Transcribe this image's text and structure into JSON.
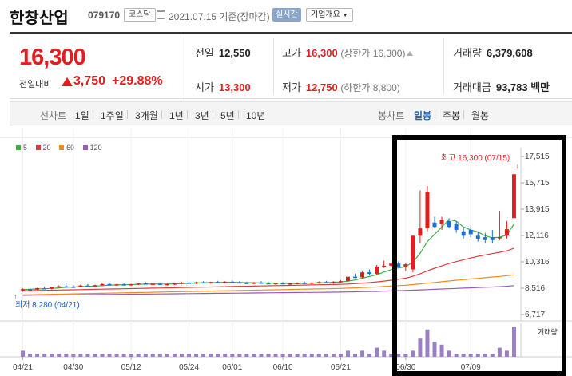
{
  "header": {
    "company_name": "한창산업",
    "stock_code": "079170",
    "market_badge": "코스닥",
    "date_text": "2021.07.15 기준(장마감)",
    "realtime_label": "실시간",
    "company_info_label": "기업개요"
  },
  "summary": {
    "current_price": "16,300",
    "change_label": "전일대비",
    "change_value": "3,750",
    "change_percent": "+29.88%",
    "prev_close_label": "전일",
    "prev_close": "12,550",
    "open_label": "시가",
    "open": "13,300",
    "high_label": "고가",
    "high": "16,300",
    "high_note": "(상한가 16,300)",
    "low_label": "저가",
    "low": "12,750",
    "low_note": "(하한가 8,800)",
    "volume_label": "거래량",
    "volume": "6,379,608",
    "trade_value_label": "거래대금",
    "trade_value": "93,783 백만"
  },
  "period_bar": {
    "line_chart_label": "선차트",
    "periods": [
      "1일",
      "1주일",
      "3개월",
      "1년",
      "3년",
      "5년",
      "10년"
    ],
    "candle_label": "봉차트",
    "candle_periods": [
      "일봉",
      "주봉",
      "월봉"
    ],
    "selected": "일봉"
  },
  "legend": [
    {
      "label": "5",
      "color": "#3cb043"
    },
    {
      "label": "20",
      "color": "#e03c3c"
    },
    {
      "label": "60",
      "color": "#f08c1e"
    },
    {
      "label": "120",
      "color": "#9b59b6"
    }
  ],
  "colors": {
    "up": "#e41e1e",
    "down": "#1a6fd6",
    "ma5": "#3cb043",
    "ma20": "#e03c3c",
    "ma60": "#f08c1e",
    "ma120": "#9b59b6",
    "volume": "#9b7fc4",
    "highlight_box": "#000000"
  },
  "chart_data": {
    "type": "candlestick",
    "y_ticks": [
      "17,515",
      "15,715",
      "13,915",
      "12,116",
      "10,316",
      "8,516",
      "6,717"
    ],
    "ylim": [
      6717,
      17515
    ],
    "x_ticks": [
      "04/21",
      "04/30",
      "05/12",
      "05/24",
      "06/01",
      "06/10",
      "06/21",
      "06/30",
      "07/09"
    ],
    "max_annotation": "최고 16,300 (07/15)",
    "min_annotation": "최저 8,280 (04/21)",
    "volume_label": "거래량",
    "candles": [
      {
        "o": 8380,
        "h": 8500,
        "l": 8280,
        "c": 8450
      },
      {
        "o": 8450,
        "h": 8560,
        "l": 8380,
        "c": 8420
      },
      {
        "o": 8420,
        "h": 8550,
        "l": 8400,
        "c": 8520
      },
      {
        "o": 8520,
        "h": 8620,
        "l": 8450,
        "c": 8480
      },
      {
        "o": 8480,
        "h": 8600,
        "l": 8440,
        "c": 8580
      },
      {
        "o": 8580,
        "h": 8700,
        "l": 8520,
        "c": 8640
      },
      {
        "o": 8640,
        "h": 8900,
        "l": 8600,
        "c": 8620
      },
      {
        "o": 8620,
        "h": 8720,
        "l": 8560,
        "c": 8600
      },
      {
        "o": 8600,
        "h": 8760,
        "l": 8580,
        "c": 8700
      },
      {
        "o": 8700,
        "h": 8800,
        "l": 8620,
        "c": 8660
      },
      {
        "o": 8660,
        "h": 8760,
        "l": 8600,
        "c": 8720
      },
      {
        "o": 8720,
        "h": 8900,
        "l": 8660,
        "c": 8800
      },
      {
        "o": 8800,
        "h": 8880,
        "l": 8700,
        "c": 8740
      },
      {
        "o": 8740,
        "h": 8820,
        "l": 8680,
        "c": 8780
      },
      {
        "o": 8780,
        "h": 8860,
        "l": 8700,
        "c": 8720
      },
      {
        "o": 8720,
        "h": 8820,
        "l": 8680,
        "c": 8790
      },
      {
        "o": 8790,
        "h": 8900,
        "l": 8740,
        "c": 8840
      },
      {
        "o": 8840,
        "h": 8920,
        "l": 8760,
        "c": 8780
      },
      {
        "o": 8780,
        "h": 8860,
        "l": 8720,
        "c": 8820
      },
      {
        "o": 8820,
        "h": 8900,
        "l": 8760,
        "c": 8760
      },
      {
        "o": 8760,
        "h": 8840,
        "l": 8700,
        "c": 8800
      },
      {
        "o": 8800,
        "h": 8880,
        "l": 8740,
        "c": 8840
      },
      {
        "o": 8840,
        "h": 8940,
        "l": 8780,
        "c": 8900
      },
      {
        "o": 8900,
        "h": 8980,
        "l": 8820,
        "c": 8860
      },
      {
        "o": 8860,
        "h": 8960,
        "l": 8800,
        "c": 8920
      },
      {
        "o": 8920,
        "h": 9000,
        "l": 8850,
        "c": 8880
      },
      {
        "o": 8880,
        "h": 8960,
        "l": 8820,
        "c": 8940
      },
      {
        "o": 8940,
        "h": 9020,
        "l": 8860,
        "c": 8900
      },
      {
        "o": 8900,
        "h": 9000,
        "l": 8840,
        "c": 8960
      },
      {
        "o": 8960,
        "h": 9040,
        "l": 8880,
        "c": 8920
      },
      {
        "o": 8920,
        "h": 9000,
        "l": 8860,
        "c": 8880
      },
      {
        "o": 8880,
        "h": 8960,
        "l": 8800,
        "c": 8840
      },
      {
        "o": 8840,
        "h": 8940,
        "l": 8780,
        "c": 8900
      },
      {
        "o": 8900,
        "h": 9000,
        "l": 8840,
        "c": 8860
      },
      {
        "o": 8860,
        "h": 8940,
        "l": 8800,
        "c": 8820
      },
      {
        "o": 8820,
        "h": 8900,
        "l": 8760,
        "c": 8860
      },
      {
        "o": 8860,
        "h": 8940,
        "l": 8800,
        "c": 8800
      },
      {
        "o": 8800,
        "h": 8880,
        "l": 8740,
        "c": 8840
      },
      {
        "o": 8840,
        "h": 8920,
        "l": 8780,
        "c": 8880
      },
      {
        "o": 8880,
        "h": 8960,
        "l": 8820,
        "c": 8840
      },
      {
        "o": 8840,
        "h": 8920,
        "l": 8780,
        "c": 8900
      },
      {
        "o": 8900,
        "h": 8980,
        "l": 8840,
        "c": 8940
      },
      {
        "o": 8940,
        "h": 9020,
        "l": 8880,
        "c": 8900
      },
      {
        "o": 8900,
        "h": 9000,
        "l": 8840,
        "c": 8960
      },
      {
        "o": 8960,
        "h": 9060,
        "l": 8900,
        "c": 9000
      },
      {
        "o": 9000,
        "h": 9400,
        "l": 8960,
        "c": 9300
      },
      {
        "o": 9300,
        "h": 9500,
        "l": 9200,
        "c": 9250
      },
      {
        "o": 9250,
        "h": 9700,
        "l": 9200,
        "c": 9600
      },
      {
        "o": 9600,
        "h": 9800,
        "l": 9400,
        "c": 9500
      },
      {
        "o": 9500,
        "h": 10100,
        "l": 9450,
        "c": 10000
      },
      {
        "o": 10000,
        "h": 10400,
        "l": 9900,
        "c": 10050
      },
      {
        "o": 10050,
        "h": 10300,
        "l": 9950,
        "c": 10200
      },
      {
        "o": 10200,
        "h": 10350,
        "l": 9950,
        "c": 9950
      },
      {
        "o": 9950,
        "h": 10200,
        "l": 9700,
        "c": 10150
      },
      {
        "o": 9800,
        "h": 12100,
        "l": 9600,
        "c": 12100
      },
      {
        "o": 12100,
        "h": 15200,
        "l": 11600,
        "c": 12600
      },
      {
        "o": 12600,
        "h": 15500,
        "l": 12400,
        "c": 15100
      },
      {
        "o": 13000,
        "h": 13400,
        "l": 12600,
        "c": 12700
      },
      {
        "o": 12900,
        "h": 13400,
        "l": 12500,
        "c": 13200
      },
      {
        "o": 13100,
        "h": 13300,
        "l": 12600,
        "c": 12700
      },
      {
        "o": 12900,
        "h": 13100,
        "l": 12300,
        "c": 12500
      },
      {
        "o": 12400,
        "h": 12600,
        "l": 11900,
        "c": 12100
      },
      {
        "o": 12500,
        "h": 12800,
        "l": 12000,
        "c": 12200
      },
      {
        "o": 12100,
        "h": 12400,
        "l": 11700,
        "c": 11900
      },
      {
        "o": 12000,
        "h": 12300,
        "l": 11600,
        "c": 11800
      },
      {
        "o": 12000,
        "h": 12500,
        "l": 11600,
        "c": 11800
      },
      {
        "o": 12000,
        "h": 13800,
        "l": 11800,
        "c": 12000
      },
      {
        "o": 12100,
        "h": 13100,
        "l": 11900,
        "c": 12550
      },
      {
        "o": 13300,
        "h": 16300,
        "l": 12750,
        "c": 16300
      }
    ],
    "ma5": [
      8420,
      8440,
      8460,
      8480,
      8500,
      8540,
      8580,
      8600,
      8620,
      8640,
      8660,
      8690,
      8720,
      8740,
      8750,
      8760,
      8780,
      8800,
      8810,
      8800,
      8800,
      8810,
      8830,
      8850,
      8870,
      8890,
      8900,
      8910,
      8920,
      8920,
      8910,
      8900,
      8890,
      8880,
      8870,
      8860,
      8850,
      8840,
      8840,
      8850,
      8860,
      8880,
      8900,
      8920,
      8940,
      9000,
      9080,
      9200,
      9320,
      9450,
      9620,
      9780,
      9900,
      9980,
      10300,
      10900,
      11700,
      12200,
      12700,
      13200,
      13100,
      12700,
      12500,
      12350,
      12100,
      11950,
      12000,
      12150,
      12900
    ],
    "ma20": [
      8340,
      8350,
      8360,
      8370,
      8380,
      8390,
      8400,
      8410,
      8420,
      8430,
      8440,
      8450,
      8460,
      8470,
      8480,
      8490,
      8500,
      8510,
      8520,
      8530,
      8540,
      8550,
      8560,
      8570,
      8580,
      8590,
      8600,
      8610,
      8620,
      8630,
      8640,
      8650,
      8660,
      8670,
      8680,
      8690,
      8700,
      8710,
      8720,
      8730,
      8740,
      8750,
      8760,
      8770,
      8780,
      8800,
      8830,
      8860,
      8900,
      8950,
      9000,
      9060,
      9130,
      9200,
      9330,
      9500,
      9700,
      9880,
      10040,
      10200,
      10330,
      10460,
      10580,
      10690,
      10790,
      10880,
      10970,
      11070,
      11250
    ],
    "ma60": [
      8060,
      8070,
      8080,
      8090,
      8100,
      8110,
      8120,
      8130,
      8140,
      8150,
      8160,
      8170,
      8180,
      8190,
      8200,
      8210,
      8220,
      8230,
      8240,
      8250,
      8260,
      8270,
      8280,
      8290,
      8300,
      8310,
      8320,
      8330,
      8340,
      8350,
      8360,
      8370,
      8380,
      8390,
      8400,
      8410,
      8420,
      8430,
      8440,
      8450,
      8460,
      8470,
      8480,
      8490,
      8500,
      8520,
      8540,
      8560,
      8580,
      8600,
      8630,
      8660,
      8690,
      8720,
      8760,
      8810,
      8860,
      8910,
      8960,
      9010,
      9060,
      9100,
      9150,
      9190,
      9230,
      9280,
      9320,
      9370,
      9430
    ],
    "ma120": [
      8030,
      8035,
      8040,
      8045,
      8050,
      8055,
      8060,
      8065,
      8070,
      8075,
      8080,
      8085,
      8090,
      8095,
      8100,
      8105,
      8110,
      8115,
      8120,
      8125,
      8130,
      8135,
      8140,
      8145,
      8150,
      8155,
      8160,
      8165,
      8170,
      8175,
      8180,
      8185,
      8190,
      8195,
      8200,
      8205,
      8210,
      8215,
      8220,
      8225,
      8230,
      8235,
      8240,
      8245,
      8250,
      8260,
      8270,
      8280,
      8290,
      8300,
      8315,
      8330,
      8345,
      8360,
      8380,
      8400,
      8420,
      8440,
      8460,
      8480,
      8500,
      8520,
      8540,
      8560,
      8580,
      8600,
      8620,
      8650,
      8690
    ],
    "volume": [
      2,
      1,
      1,
      1,
      1,
      1,
      1,
      1,
      1,
      1,
      1,
      1,
      1,
      1,
      1,
      1,
      1,
      1,
      1,
      1,
      1,
      1,
      1,
      1,
      1,
      1,
      1,
      1,
      1,
      1,
      1,
      1,
      1,
      1,
      1,
      1,
      1,
      1,
      1,
      1,
      1,
      1,
      1,
      1,
      1,
      2,
      1,
      2,
      1,
      3,
      2,
      1,
      1,
      1,
      2,
      6,
      9,
      5,
      4,
      2,
      1,
      1,
      1,
      1,
      1,
      1,
      3,
      2,
      10
    ]
  }
}
